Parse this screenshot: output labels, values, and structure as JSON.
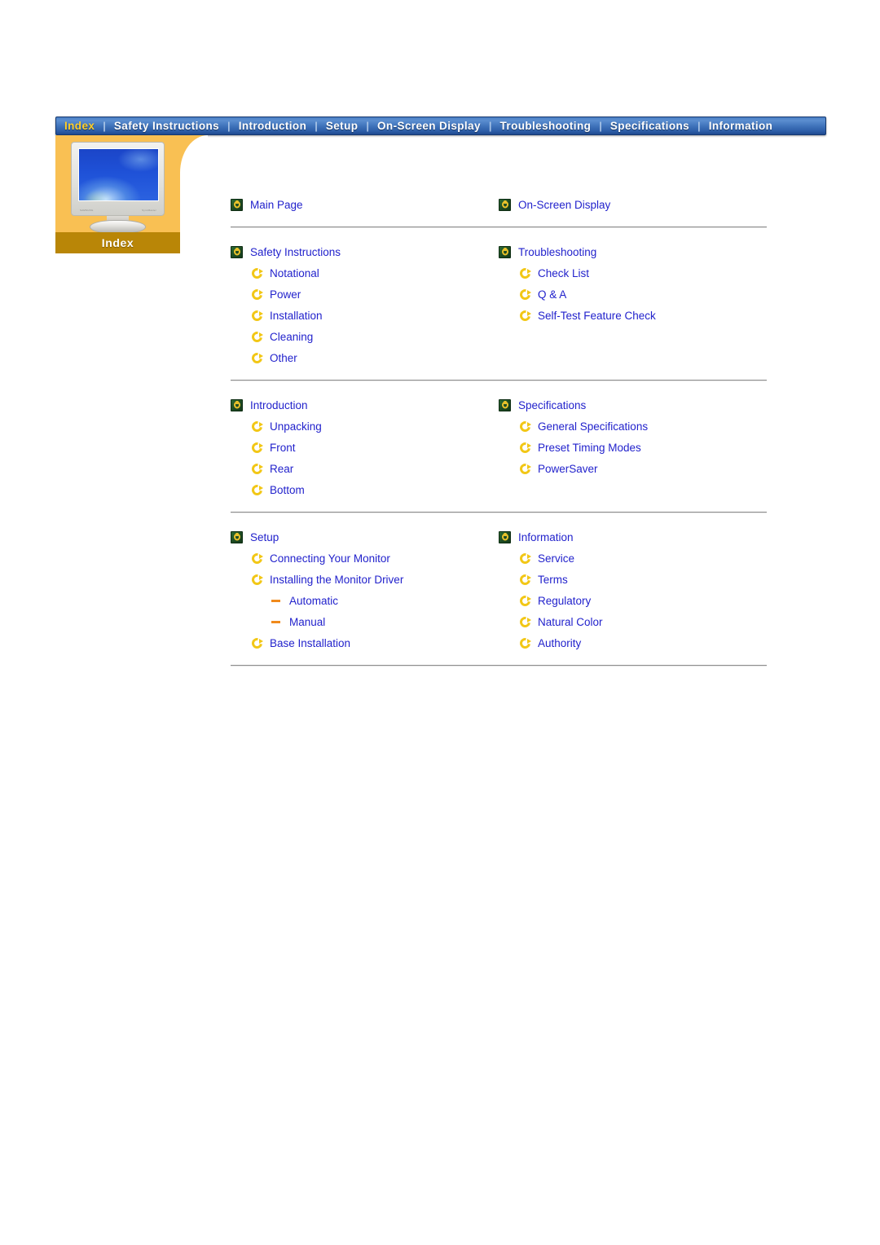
{
  "nav": {
    "items": [
      {
        "label": "Index",
        "active": true
      },
      {
        "label": "Safety Instructions",
        "active": false
      },
      {
        "label": "Introduction",
        "active": false
      },
      {
        "label": "Setup",
        "active": false
      },
      {
        "label": "On-Screen Display",
        "active": false
      },
      {
        "label": "Troubleshooting",
        "active": false
      },
      {
        "label": "Specifications",
        "active": false
      },
      {
        "label": "Information",
        "active": false
      }
    ],
    "separator": "|"
  },
  "side_panel": {
    "caption": "Index",
    "monitor_brand_left": "SAMSUNG",
    "monitor_brand_right": "SyncMaster",
    "colors": {
      "panel": "#f9c053",
      "caption_bar": "#b98607",
      "screen": "#1f52d8"
    }
  },
  "colors": {
    "link": "#2222cc",
    "nav_active": "#ffcf2a",
    "icon_green": "#1d4a22",
    "icon_gold": "#e9c22a",
    "icon_arrow": "#f2c716",
    "icon_dash": "#f08a1c",
    "divider": "#8e8e8e"
  },
  "groups": [
    {
      "left": [
        {
          "label": "Main Page",
          "level": 1,
          "icon": "green-ring-icon"
        }
      ],
      "right": [
        {
          "label": "On-Screen Display",
          "level": 1,
          "icon": "green-ring-icon"
        }
      ]
    },
    {
      "left": [
        {
          "label": "Safety Instructions",
          "level": 1,
          "icon": "green-ring-icon"
        },
        {
          "label": "Notational",
          "level": 2,
          "icon": "circular-arrow-icon"
        },
        {
          "label": "Power",
          "level": 2,
          "icon": "circular-arrow-icon"
        },
        {
          "label": "Installation",
          "level": 2,
          "icon": "circular-arrow-icon"
        },
        {
          "label": "Cleaning",
          "level": 2,
          "icon": "circular-arrow-icon"
        },
        {
          "label": "Other",
          "level": 2,
          "icon": "circular-arrow-icon"
        }
      ],
      "right": [
        {
          "label": "Troubleshooting",
          "level": 1,
          "icon": "green-ring-icon"
        },
        {
          "label": "Check List",
          "level": 2,
          "icon": "circular-arrow-icon"
        },
        {
          "label": "Q & A",
          "level": 2,
          "icon": "circular-arrow-icon"
        },
        {
          "label": "Self-Test Feature Check",
          "level": 2,
          "icon": "circular-arrow-icon"
        }
      ]
    },
    {
      "left": [
        {
          "label": "Introduction",
          "level": 1,
          "icon": "green-ring-icon"
        },
        {
          "label": "Unpacking",
          "level": 2,
          "icon": "circular-arrow-icon"
        },
        {
          "label": "Front",
          "level": 2,
          "icon": "circular-arrow-icon"
        },
        {
          "label": "Rear",
          "level": 2,
          "icon": "circular-arrow-icon"
        },
        {
          "label": "Bottom",
          "level": 2,
          "icon": "circular-arrow-icon"
        }
      ],
      "right": [
        {
          "label": "Specifications",
          "level": 1,
          "icon": "green-ring-icon"
        },
        {
          "label": "General Specifications",
          "level": 2,
          "icon": "circular-arrow-icon"
        },
        {
          "label": "Preset Timing Modes",
          "level": 2,
          "icon": "circular-arrow-icon"
        },
        {
          "label": "PowerSaver",
          "level": 2,
          "icon": "circular-arrow-icon"
        }
      ]
    },
    {
      "left": [
        {
          "label": "Setup",
          "level": 1,
          "icon": "green-ring-icon"
        },
        {
          "label": "Connecting Your Monitor",
          "level": 2,
          "icon": "circular-arrow-icon"
        },
        {
          "label": "Installing the Monitor Driver",
          "level": 2,
          "icon": "circular-arrow-icon"
        },
        {
          "label": "Automatic",
          "level": 3,
          "icon": "dash-icon"
        },
        {
          "label": "Manual",
          "level": 3,
          "icon": "dash-icon"
        },
        {
          "label": "Base Installation",
          "level": 2,
          "icon": "circular-arrow-icon"
        }
      ],
      "right": [
        {
          "label": "Information",
          "level": 1,
          "icon": "green-ring-icon"
        },
        {
          "label": "Service",
          "level": 2,
          "icon": "circular-arrow-icon"
        },
        {
          "label": "Terms",
          "level": 2,
          "icon": "circular-arrow-icon"
        },
        {
          "label": "Regulatory",
          "level": 2,
          "icon": "circular-arrow-icon"
        },
        {
          "label": "Natural Color",
          "level": 2,
          "icon": "circular-arrow-icon"
        },
        {
          "label": "Authority",
          "level": 2,
          "icon": "circular-arrow-icon"
        }
      ]
    }
  ]
}
